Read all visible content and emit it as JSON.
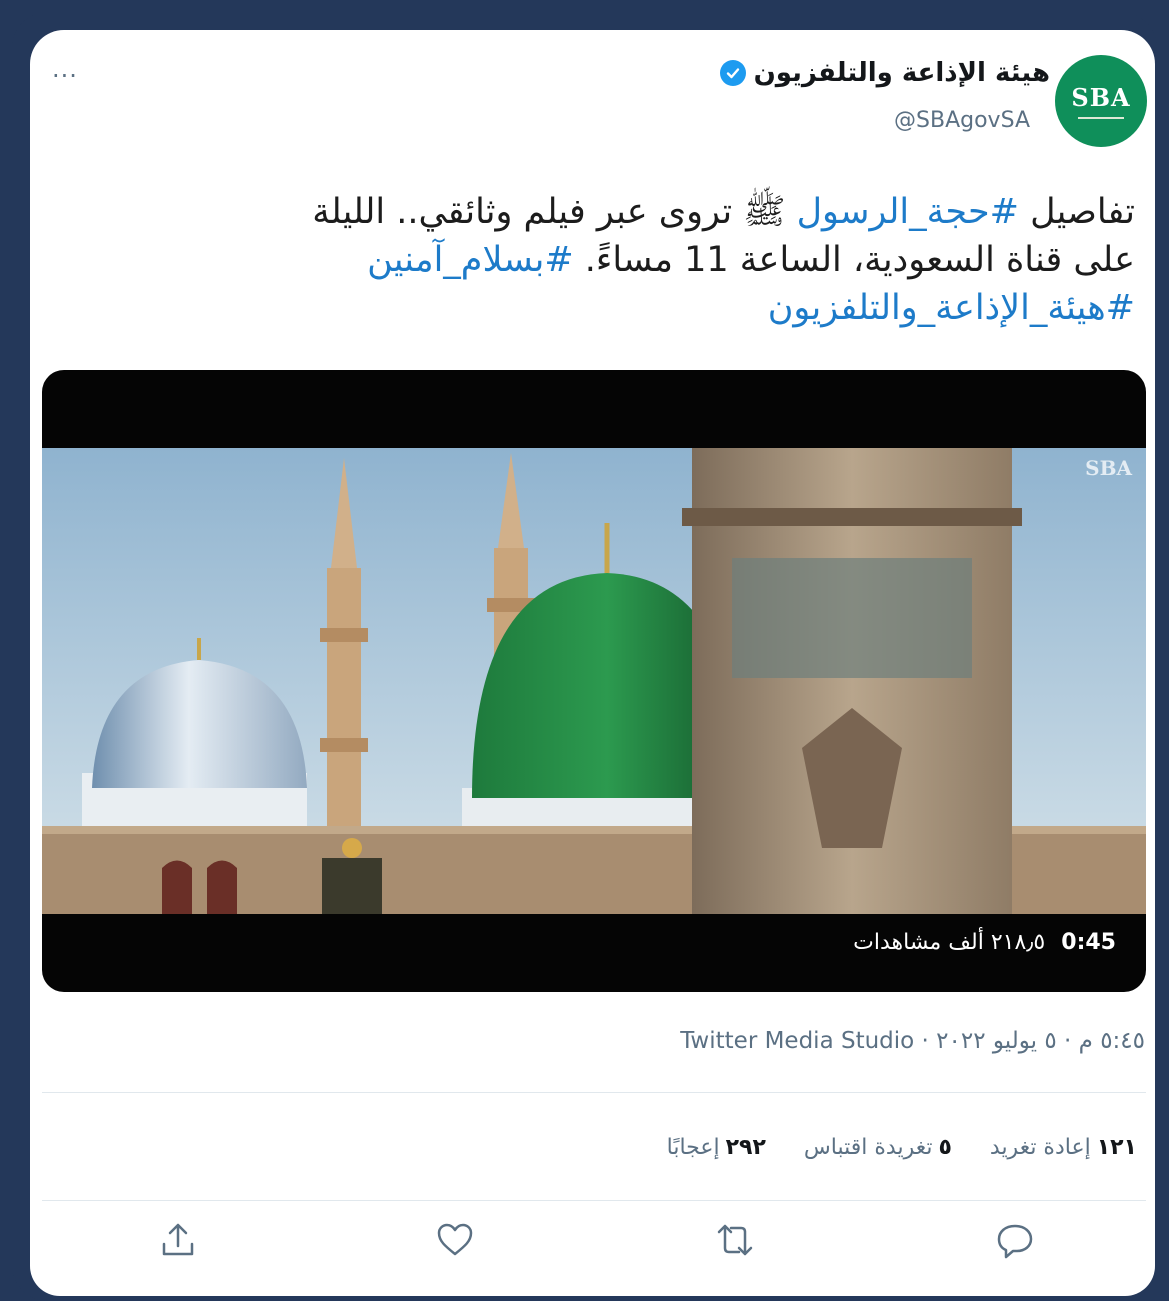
{
  "account": {
    "display_name": "هيئة الإذاعة والتلفزيون",
    "handle": "@SBAgovSA",
    "avatar_text": "SBA",
    "verified": true
  },
  "menu": {
    "more_label": "···"
  },
  "tweet": {
    "line1_prefix": "تفاصيل ",
    "hashtag1": "#حجة_الرسول",
    "line1_suffix": " ﷺ تروى عبر فيلم وثائقي.. الليلة",
    "line2_text": "على قناة السعودية، الساعة 11 مساءً. ",
    "hashtag2": "#بسلام_آمنين",
    "hashtag3": "#هيئة_الإذاعة_والتلفزيون"
  },
  "media": {
    "watermark": "SBA",
    "duration": "0:45",
    "views": "٢١٨٫٥ ألف مشاهدات"
  },
  "meta": {
    "timestamp_source": "٥:٤٥ م · ٥ يوليو ٢٠٢٢ · Twitter Media Studio"
  },
  "stats": {
    "retweets_count": "١٢١",
    "retweets_label": "إعادة تغريد",
    "quotes_count": "٥",
    "quotes_label": "تغريدة اقتباس",
    "likes_count": "٢٩٢",
    "likes_label": "إعجابًا"
  },
  "colors": {
    "frame": "#24385a",
    "link": "#1d7bc9",
    "verified": "#1d9bf0",
    "avatar": "#0f8f5a"
  }
}
